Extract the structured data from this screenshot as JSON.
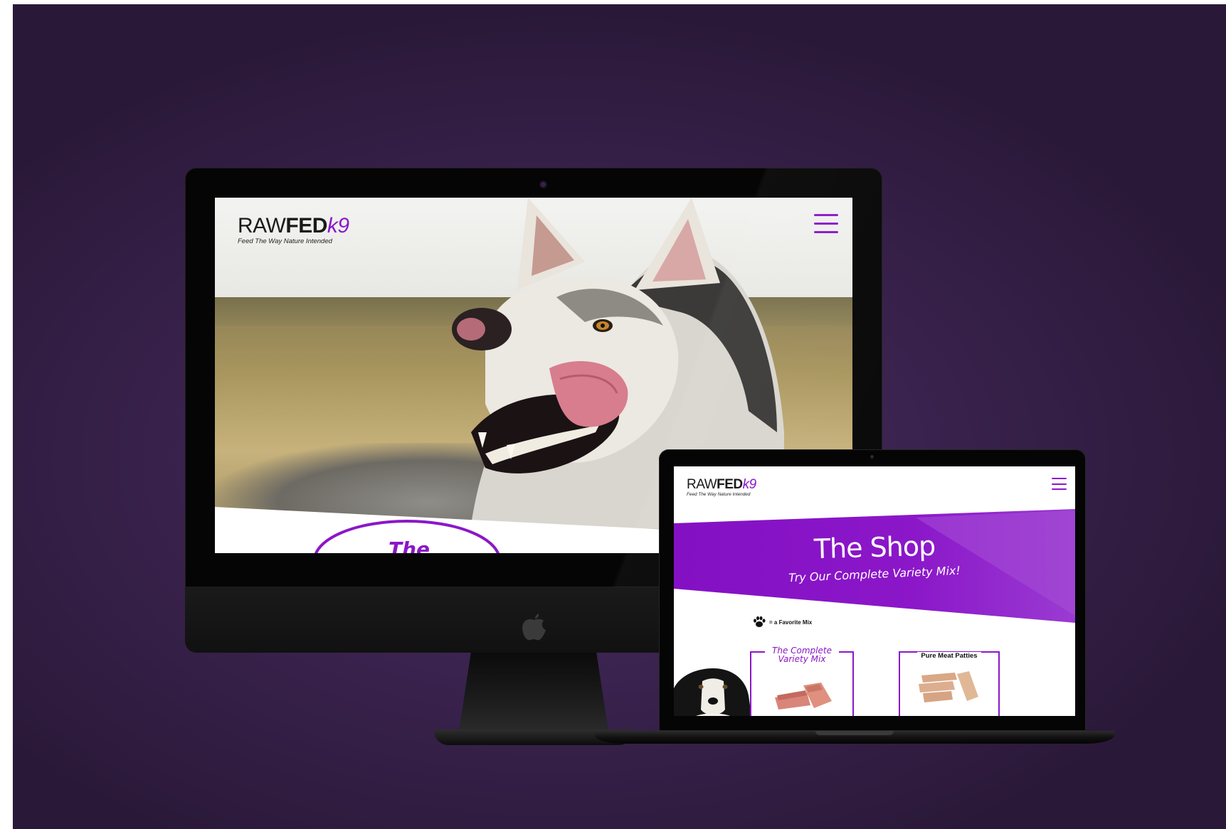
{
  "brand": {
    "name_part1": "RAW",
    "name_part2": "FED",
    "name_part3": "k9",
    "tagline": "Feed The Way Nature Intended"
  },
  "desktop_site": {
    "hero_partial_heading": "The",
    "menu_icon": "hamburger-menu-icon"
  },
  "laptop_site": {
    "menu_icon": "hamburger-menu-icon",
    "page_title": "The Shop",
    "page_subtitle": "Try Our Complete Variety Mix!",
    "legend_text": "= a Favorite Mix",
    "legend_icon": "paw-icon",
    "products": [
      {
        "title_line1": "The Complete",
        "title_line2": "Variety Mix"
      },
      {
        "title_line1": "Pure Meat Patties",
        "title_line2": ""
      }
    ]
  },
  "colors": {
    "accent": "#8b17c9",
    "background": "#3b2450",
    "device": "#050505"
  }
}
